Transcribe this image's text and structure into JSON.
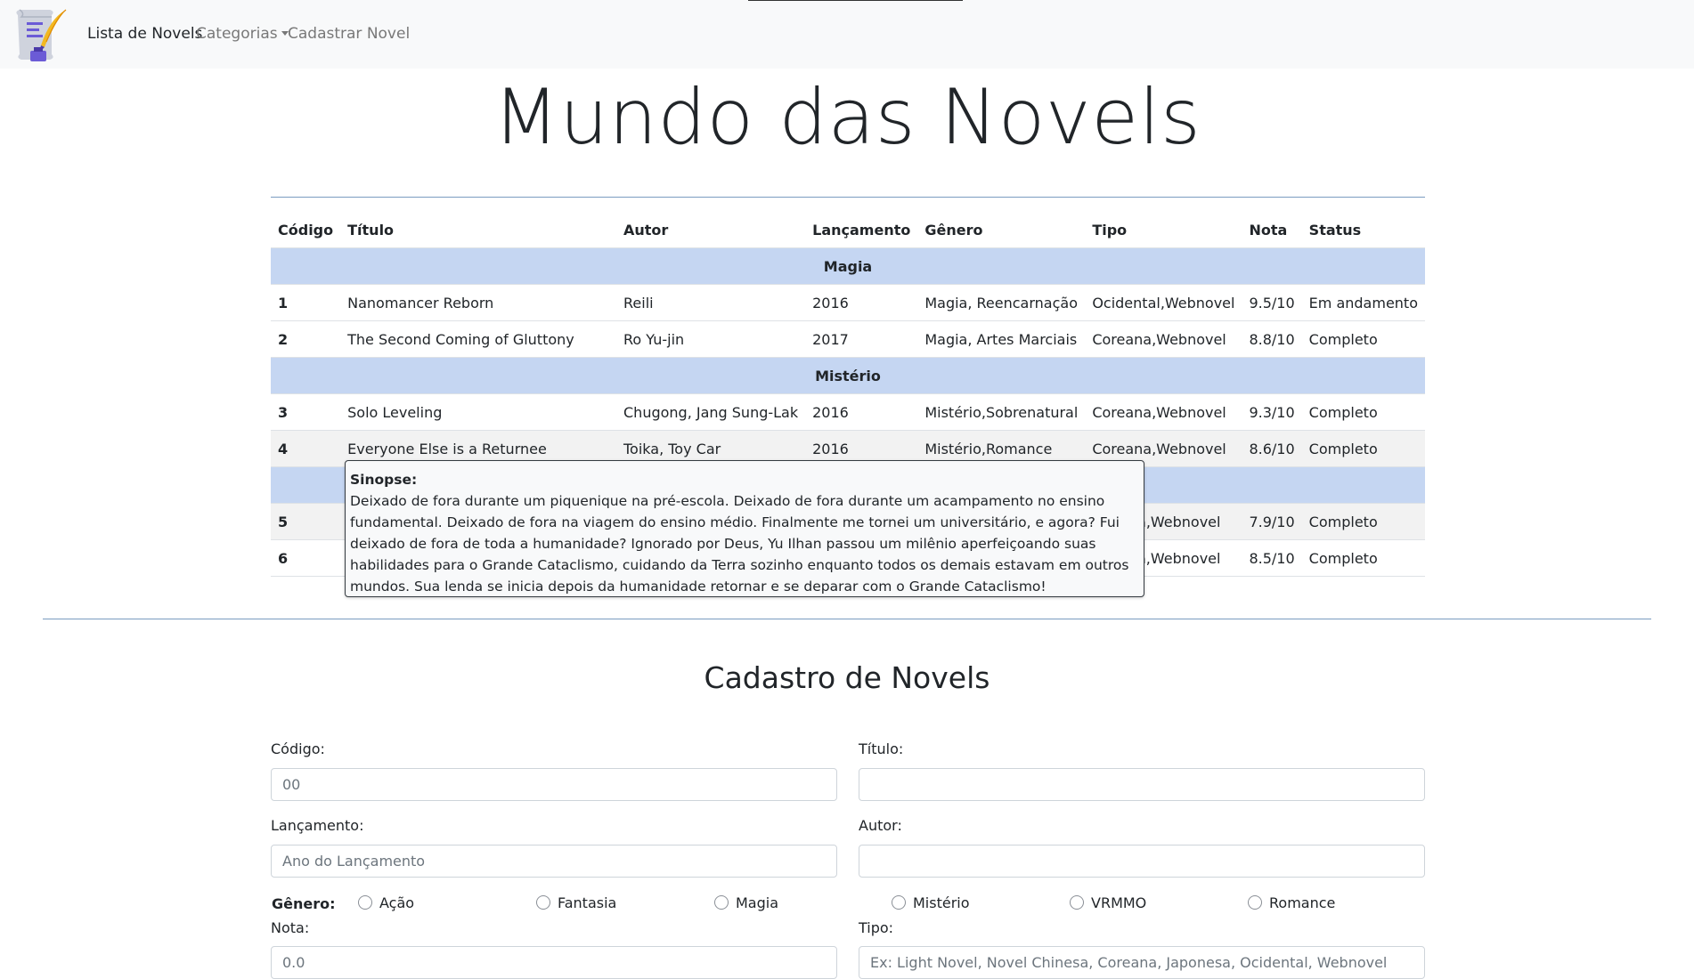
{
  "navbar": {
    "logo_icon": "scroll-quill-logo-icon",
    "items": [
      {
        "label": "Lista de Novels",
        "active": true
      },
      {
        "label": "Categorias",
        "dropdown": true
      },
      {
        "label": "Cadastrar Novel"
      }
    ]
  },
  "page": {
    "title": "Mundo das Novels"
  },
  "table": {
    "headers": [
      "Código",
      "Título",
      "Autor",
      "Lançamento",
      "Gênero",
      "Tipo",
      "Nota",
      "Status"
    ],
    "groups": [
      {
        "category": "Magia",
        "rows": [
          {
            "code": "1",
            "title": "Nanomancer Reborn",
            "author": "Reili",
            "year": "2016",
            "genre": "Magia, Reencarnação",
            "type": "Ocidental,Webnovel",
            "rating": "9.5/10",
            "status": "Em andamento"
          },
          {
            "code": "2",
            "title": "The Second Coming of Gluttony",
            "author": "Ro Yu-jin",
            "year": "2017",
            "genre": "Magia, Artes Marciais",
            "type": "Coreana,Webnovel",
            "rating": "8.8/10",
            "status": "Completo"
          }
        ]
      },
      {
        "category": "Mistério",
        "rows": [
          {
            "code": "3",
            "title": "Solo Leveling",
            "author": "Chugong, Jang Sung-Lak",
            "year": "2016",
            "genre": "Mistério,Sobrenatural",
            "type": "Coreana,Webnovel",
            "rating": "9.3/10",
            "status": "Completo"
          },
          {
            "code": "4",
            "title": "Everyone Else is a Returnee",
            "author": "Toika, Toy Car",
            "year": "2016",
            "genre": "Mistério,Romance",
            "type": "Coreana,Webnovel",
            "rating": "8.6/10",
            "status": "Completo"
          }
        ]
      },
      {
        "category": "",
        "rows": [
          {
            "code": "5",
            "title": "",
            "author": "",
            "year": "",
            "genre": "",
            "type": "sa,Webnovel",
            "rating": "7.9/10",
            "status": "Completo"
          },
          {
            "code": "6",
            "title": "",
            "author": "",
            "year": "",
            "genre": "",
            "type": "na,Webnovel",
            "rating": "8.5/10",
            "status": "Completo"
          }
        ]
      }
    ]
  },
  "tooltip": {
    "label": "Sinopse:",
    "text": "Deixado de fora durante um piquenique na pré-escola. Deixado de fora durante um acampamento no ensino fundamental. Deixado de fora na viagem do ensino médio. Finalmente me tornei um universitário, e agora? Fui deixado de fora de toda a humanidade? Ignorado por Deus, Yu Ilhan passou um milênio aperfeiçoando suas habilidades para o Grande Cataclismo, cuidando da Terra sozinho enquanto todos os demais estavam em outros mundos. Sua lenda se inicia depois da humanidade retornar e se deparar com o Grande Cataclismo!"
  },
  "form": {
    "title": "Cadastro de Novels",
    "codigo": {
      "label": "Código:",
      "placeholder": "00"
    },
    "titulo": {
      "label": "Título:",
      "placeholder": ""
    },
    "lancamento": {
      "label": "Lançamento:",
      "placeholder": "Ano do Lançamento"
    },
    "autor": {
      "label": "Autor:",
      "placeholder": ""
    },
    "genero": {
      "label": "Gênero:",
      "options": [
        "Ação",
        "Fantasia",
        "Magia",
        "Mistério",
        "VRMMO",
        "Romance"
      ]
    },
    "nota": {
      "label": "Nota:",
      "placeholder": "0.0"
    },
    "tipo": {
      "label": "Tipo:",
      "placeholder": "Ex: Light Novel, Novel Chinesa, Coreana, Japonesa, Ocidental, Webnovel"
    }
  }
}
